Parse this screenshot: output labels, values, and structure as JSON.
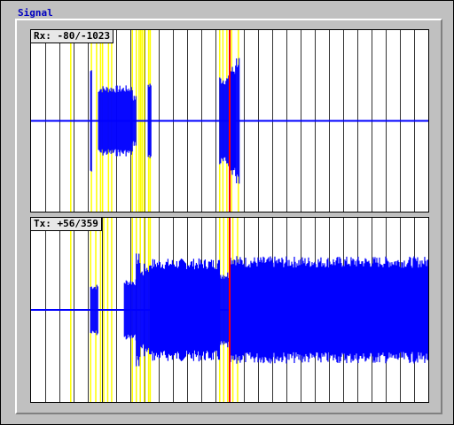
{
  "window": {
    "title": "Signal"
  },
  "colors": {
    "background": "#c0c0c0",
    "plot_bg": "#ffffff",
    "grid": "#000000",
    "signal": "#0000ff",
    "marker": "#ffff00",
    "cursor": "#ff0000",
    "title": "#0000c0"
  },
  "rx": {
    "label": "Rx: -80/-1023"
  },
  "tx": {
    "label": "Tx: +56/359"
  },
  "chart_data": [
    {
      "type": "line",
      "name": "rx",
      "grid_divisions": 28,
      "amplitude_range": [
        -1,
        1
      ],
      "baseline": 0,
      "envelope": [
        {
          "start": 0.15,
          "end": 0.154,
          "amp": 0.55
        },
        {
          "start": 0.17,
          "end": 0.255,
          "amp": 0.35
        },
        {
          "start": 0.255,
          "end": 0.265,
          "amp": 0.25
        },
        {
          "start": 0.295,
          "end": 0.302,
          "amp": 0.4
        },
        {
          "start": 0.475,
          "end": 0.5,
          "amp": 0.45
        },
        {
          "start": 0.5,
          "end": 0.515,
          "amp": 0.55
        },
        {
          "start": 0.515,
          "end": 0.525,
          "amp": 0.65
        }
      ],
      "markers": [
        0.1,
        0.152,
        0.165,
        0.175,
        0.18,
        0.195,
        0.203,
        0.255,
        0.265,
        0.272,
        0.276,
        0.28,
        0.285,
        0.296,
        0.3,
        0.475,
        0.483,
        0.493,
        0.505,
        0.522
      ],
      "cursor": 0.5
    },
    {
      "type": "line",
      "name": "tx",
      "grid_divisions": 28,
      "amplitude_range": [
        -1,
        1
      ],
      "baseline": 0,
      "envelope": [
        {
          "start": 0.15,
          "end": 0.17,
          "amp": 0.25
        },
        {
          "start": 0.235,
          "end": 0.265,
          "amp": 0.3
        },
        {
          "start": 0.265,
          "end": 0.275,
          "amp": 0.55
        },
        {
          "start": 0.275,
          "end": 0.285,
          "amp": 0.4
        },
        {
          "start": 0.285,
          "end": 0.3,
          "amp": 0.45
        },
        {
          "start": 0.3,
          "end": 0.475,
          "amp": 0.5
        },
        {
          "start": 0.475,
          "end": 0.5,
          "amp": 0.38
        },
        {
          "start": 0.5,
          "end": 0.52,
          "amp": 0.55
        },
        {
          "start": 0.52,
          "end": 1.0,
          "amp": 0.52
        }
      ],
      "markers": [
        0.1,
        0.15,
        0.163,
        0.175,
        0.183,
        0.193,
        0.203,
        0.255,
        0.265,
        0.275,
        0.285,
        0.296,
        0.3,
        0.475,
        0.485,
        0.495,
        0.508,
        0.52
      ],
      "cursor": 0.5
    }
  ]
}
